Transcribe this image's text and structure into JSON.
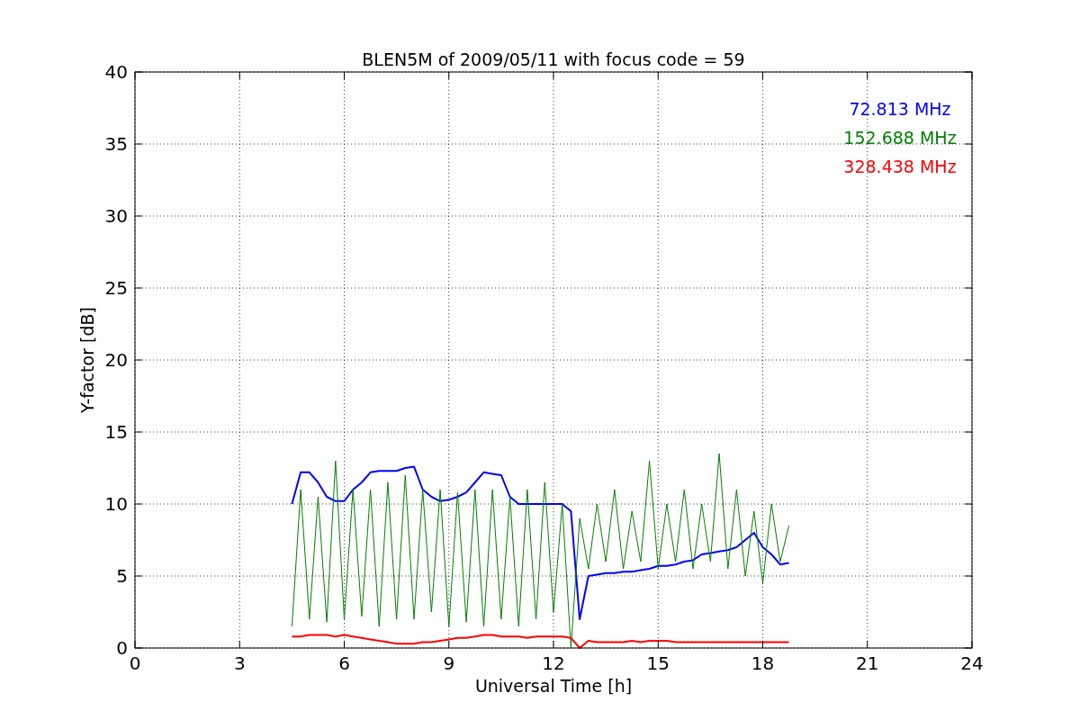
{
  "figure": {
    "chart_data": {
      "type": "line",
      "title": "BLEN5M of 2009/05/11 with focus code = 59",
      "xlabel": "Universal Time [h]",
      "ylabel": "Y-factor [dB]",
      "x": [
        4.5,
        4.75,
        5,
        5.25,
        5.5,
        5.75,
        6,
        6.25,
        6.5,
        6.75,
        7,
        7.25,
        7.5,
        7.75,
        8,
        8.25,
        8.5,
        8.75,
        9,
        9.25,
        9.5,
        9.75,
        10,
        10.25,
        10.5,
        10.75,
        11,
        11.25,
        11.5,
        11.75,
        12,
        12.25,
        12.5,
        12.75,
        13,
        13.25,
        13.5,
        13.75,
        14,
        14.25,
        14.5,
        14.75,
        15,
        15.25,
        15.5,
        15.75,
        16,
        16.25,
        16.5,
        16.75,
        17,
        17.25,
        17.5,
        17.75,
        18,
        18.25,
        18.5,
        18.75
      ],
      "series": [
        {
          "name": "72.813 MHz",
          "color": "#0000ff",
          "values": [
            10,
            12.2,
            12.2,
            11.5,
            10.5,
            10.2,
            10.2,
            11,
            11.5,
            12.2,
            12.3,
            12.3,
            12.3,
            12.5,
            12.6,
            11,
            10.5,
            10.2,
            10.3,
            10.5,
            10.8,
            11.5,
            12.2,
            12.1,
            12,
            10.5,
            10,
            10,
            10,
            10,
            10,
            10,
            9.5,
            2,
            5,
            5.1,
            5.2,
            5.2,
            5.3,
            5.3,
            5.4,
            5.5,
            5.7,
            5.7,
            5.8,
            6,
            6.1,
            6.5,
            6.6,
            6.7,
            6.8,
            7,
            7.5,
            8,
            7,
            6.5,
            5.8,
            5.9
          ]
        },
        {
          "name": "152.688 MHz",
          "color": "#008000",
          "values": [
            1.5,
            11,
            2,
            10.5,
            1.8,
            13,
            2,
            11,
            2.2,
            11,
            1.5,
            11.5,
            2,
            12,
            2,
            11,
            2.5,
            11,
            1.5,
            10.8,
            1.8,
            11,
            1.5,
            11,
            2,
            10.5,
            1.5,
            11,
            2,
            11.5,
            2.5,
            10,
            0,
            9,
            5.5,
            10,
            6,
            11,
            5.5,
            9.5,
            6,
            13,
            5.5,
            10,
            6,
            11,
            5.5,
            10,
            6,
            13.5,
            5.5,
            11,
            5,
            9.5,
            4.5,
            10,
            6,
            8.5
          ]
        },
        {
          "name": "328.438 MHz",
          "color": "#ff0000",
          "values": [
            0.8,
            0.8,
            0.9,
            0.9,
            0.9,
            0.8,
            0.9,
            0.8,
            0.7,
            0.6,
            0.5,
            0.4,
            0.3,
            0.3,
            0.3,
            0.4,
            0.4,
            0.5,
            0.6,
            0.7,
            0.7,
            0.8,
            0.9,
            0.9,
            0.8,
            0.8,
            0.8,
            0.7,
            0.8,
            0.8,
            0.8,
            0.8,
            0.7,
            0,
            0.5,
            0.4,
            0.4,
            0.4,
            0.4,
            0.5,
            0.4,
            0.5,
            0.5,
            0.5,
            0.4,
            0.4,
            0.4,
            0.4,
            0.4,
            0.4,
            0.4,
            0.4,
            0.4,
            0.4,
            0.4,
            0.4,
            0.4,
            0.4
          ]
        }
      ],
      "grid": true,
      "xlim": [
        0,
        24
      ],
      "ylim": [
        0,
        40
      ],
      "xticks": [
        0,
        3,
        6,
        9,
        12,
        15,
        18,
        21,
        24
      ],
      "yticks": [
        0,
        5,
        10,
        15,
        20,
        25,
        30,
        35,
        40
      ]
    }
  }
}
